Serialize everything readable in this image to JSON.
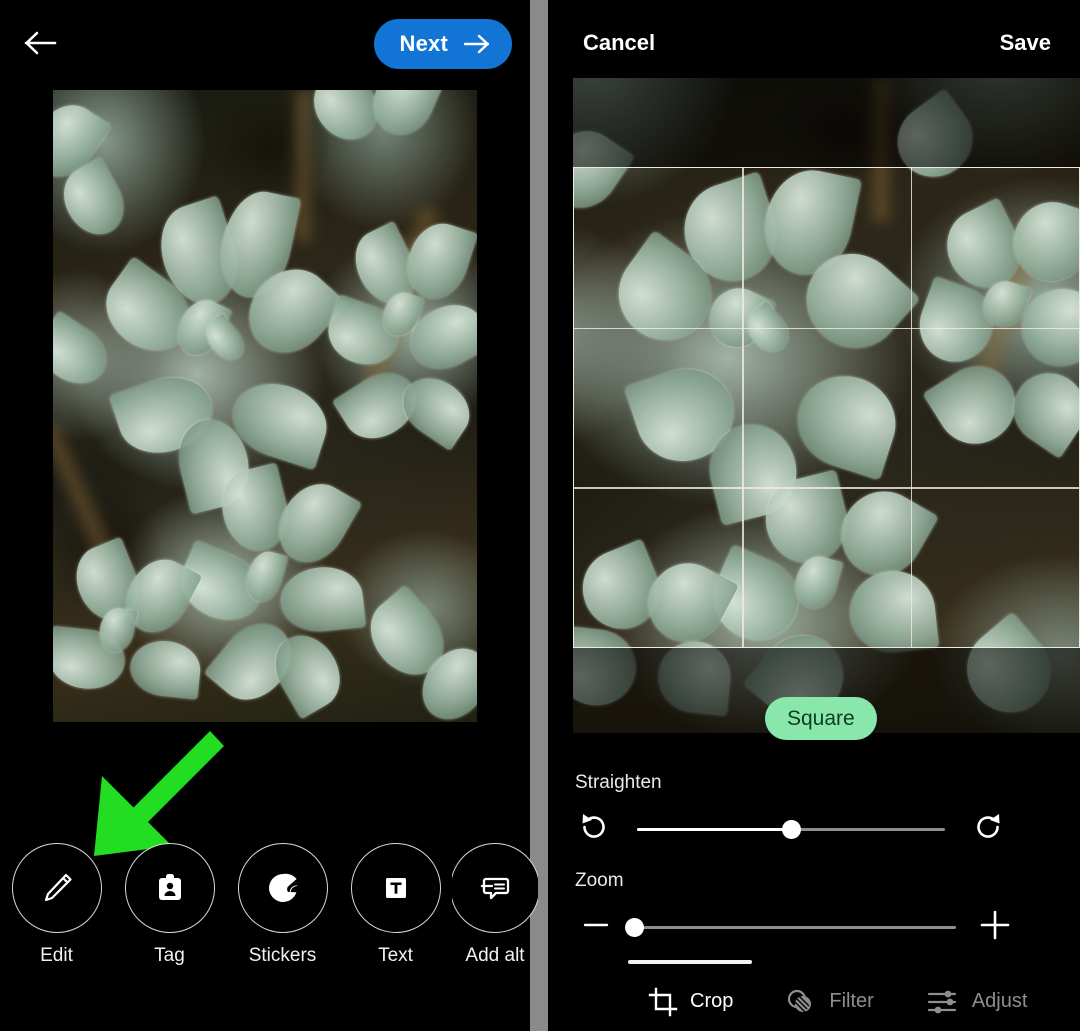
{
  "left_panel": {
    "header": {
      "back_icon": "arrow-left-icon",
      "next_label": "Next",
      "next_icon": "arrow-right-icon",
      "next_color": "#1274d4"
    },
    "photo": {
      "alt": "Close-up photograph of pale sage-green succulent rosettes (echeveria) on a dark brown soil background"
    },
    "annotation": {
      "arrow_color": "#22dd22",
      "points_to": "Edit"
    },
    "tools": [
      {
        "label": "Edit",
        "icon": "pencil-icon"
      },
      {
        "label": "Tag",
        "icon": "tag-person-icon"
      },
      {
        "label": "Stickers",
        "icon": "sticker-icon"
      },
      {
        "label": "Text",
        "icon": "text-box-icon"
      },
      {
        "label": "Add alt",
        "icon": "alt-text-bubble-icon"
      }
    ]
  },
  "right_panel": {
    "header": {
      "cancel_label": "Cancel",
      "save_label": "Save"
    },
    "photo": {
      "alt": "Same succulent photograph shown inside the crop editor with a rule-of-thirds grid overlay"
    },
    "crop": {
      "aspect_label": "Square",
      "aspect_pill_color": "#89e7ab",
      "aspect_text_color": "#0f3c22",
      "grid": "rule-of-thirds"
    },
    "straighten": {
      "label": "Straighten",
      "rotate_left_icon": "rotate-counterclockwise-icon",
      "rotate_right_icon": "rotate-clockwise-icon",
      "value_percent": 50
    },
    "zoom": {
      "label": "Zoom",
      "minus_icon": "minus-icon",
      "plus_icon": "plus-icon",
      "value_percent": 0
    },
    "tabs": [
      {
        "label": "Crop",
        "icon": "crop-icon",
        "active": true
      },
      {
        "label": "Filter",
        "icon": "filter-circles-icon",
        "active": false
      },
      {
        "label": "Adjust",
        "icon": "sliders-icon",
        "active": false
      }
    ]
  }
}
